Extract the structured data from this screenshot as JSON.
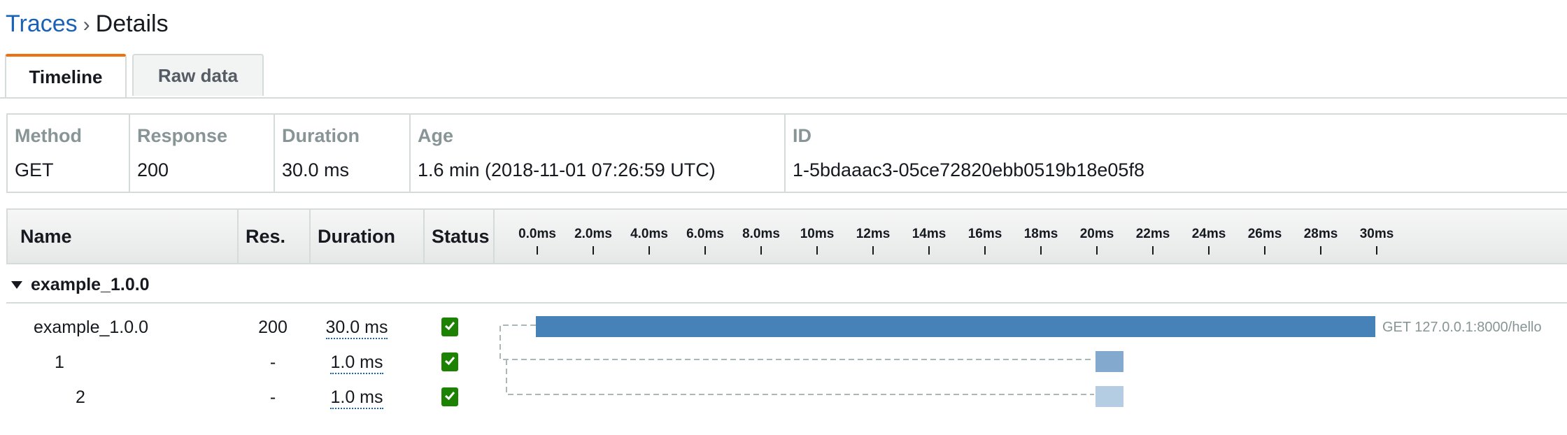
{
  "breadcrumb": {
    "parent": "Traces",
    "separator": "›",
    "current": "Details"
  },
  "tabs": [
    {
      "label": "Timeline",
      "active": true
    },
    {
      "label": "Raw data",
      "active": false
    }
  ],
  "summary": {
    "method": {
      "label": "Method",
      "value": "GET"
    },
    "response": {
      "label": "Response",
      "value": "200"
    },
    "duration": {
      "label": "Duration",
      "value": "30.0 ms"
    },
    "age": {
      "label": "Age",
      "value": "1.6 min (2018-11-01 07:26:59 UTC)"
    },
    "id": {
      "label": "ID",
      "value": "1-5bdaaac3-05ce72820ebb0519b18e05f8"
    }
  },
  "table": {
    "headers": {
      "name": "Name",
      "res": "Res.",
      "duration": "Duration",
      "status": "Status"
    },
    "ticks": [
      "0.0ms",
      "2.0ms",
      "4.0ms",
      "6.0ms",
      "8.0ms",
      "10ms",
      "12ms",
      "14ms",
      "16ms",
      "18ms",
      "20ms",
      "22ms",
      "24ms",
      "26ms",
      "28ms",
      "30ms"
    ],
    "group": {
      "label": "example_1.0.0",
      "expanded": true
    },
    "rows": [
      {
        "name": "example_1.0.0",
        "res": "200",
        "duration": "30.0 ms",
        "status": "ok",
        "start_ms": 0.0,
        "dur_ms": 30.0,
        "bar_color": "#4682b8",
        "bar_label": "GET 127.0.0.1:8000/hello"
      },
      {
        "name": "1",
        "res": "-",
        "duration": "1.0 ms",
        "status": "ok",
        "start_ms": 20.0,
        "dur_ms": 1.0,
        "bar_color": "#83a9cf",
        "bar_label": ""
      },
      {
        "name": "2",
        "res": "-",
        "duration": "1.0 ms",
        "status": "ok",
        "start_ms": 20.0,
        "dur_ms": 1.0,
        "bar_color": "#b4cde3",
        "bar_label": ""
      }
    ]
  },
  "colors": {
    "accent_tab": "#ec7211",
    "link": "#1a62b8",
    "status_ok": "#1d8102"
  }
}
